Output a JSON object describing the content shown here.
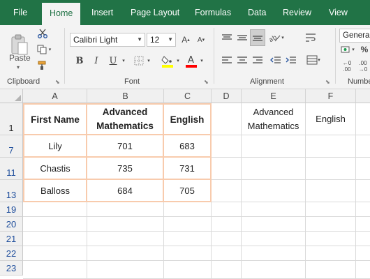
{
  "tabs": [
    "File",
    "Home",
    "Insert",
    "Page Layout",
    "Formulas",
    "Data",
    "Review",
    "View"
  ],
  "ribbon": {
    "clipboard": {
      "label": "Clipboard",
      "paste_label": "Paste"
    },
    "font": {
      "label": "Font",
      "font_name": "Calibri Light",
      "font_size": "12"
    },
    "alignment": {
      "label": "Alignment"
    },
    "number": {
      "label": "Numbe",
      "format": "General"
    }
  },
  "columns": [
    "A",
    "B",
    "C",
    "D",
    "E",
    "F"
  ],
  "rows": [
    "1",
    "7",
    "11",
    "13",
    "19",
    "20",
    "21",
    "22",
    "23"
  ],
  "table": {
    "headers": [
      "First Name",
      "Advanced Mathematics",
      "English"
    ],
    "rows": [
      [
        "Lily",
        "701",
        "683"
      ],
      [
        "Chastis",
        "735",
        "731"
      ],
      [
        "Balloss",
        "684",
        "705"
      ]
    ]
  },
  "criteria": {
    "e1": "Advanced Mathematics",
    "f1": "English"
  },
  "colors": {
    "ribbon_green": "#217346",
    "table_border": "#f8cbad",
    "row_number_blue": "#1f4e9c"
  }
}
